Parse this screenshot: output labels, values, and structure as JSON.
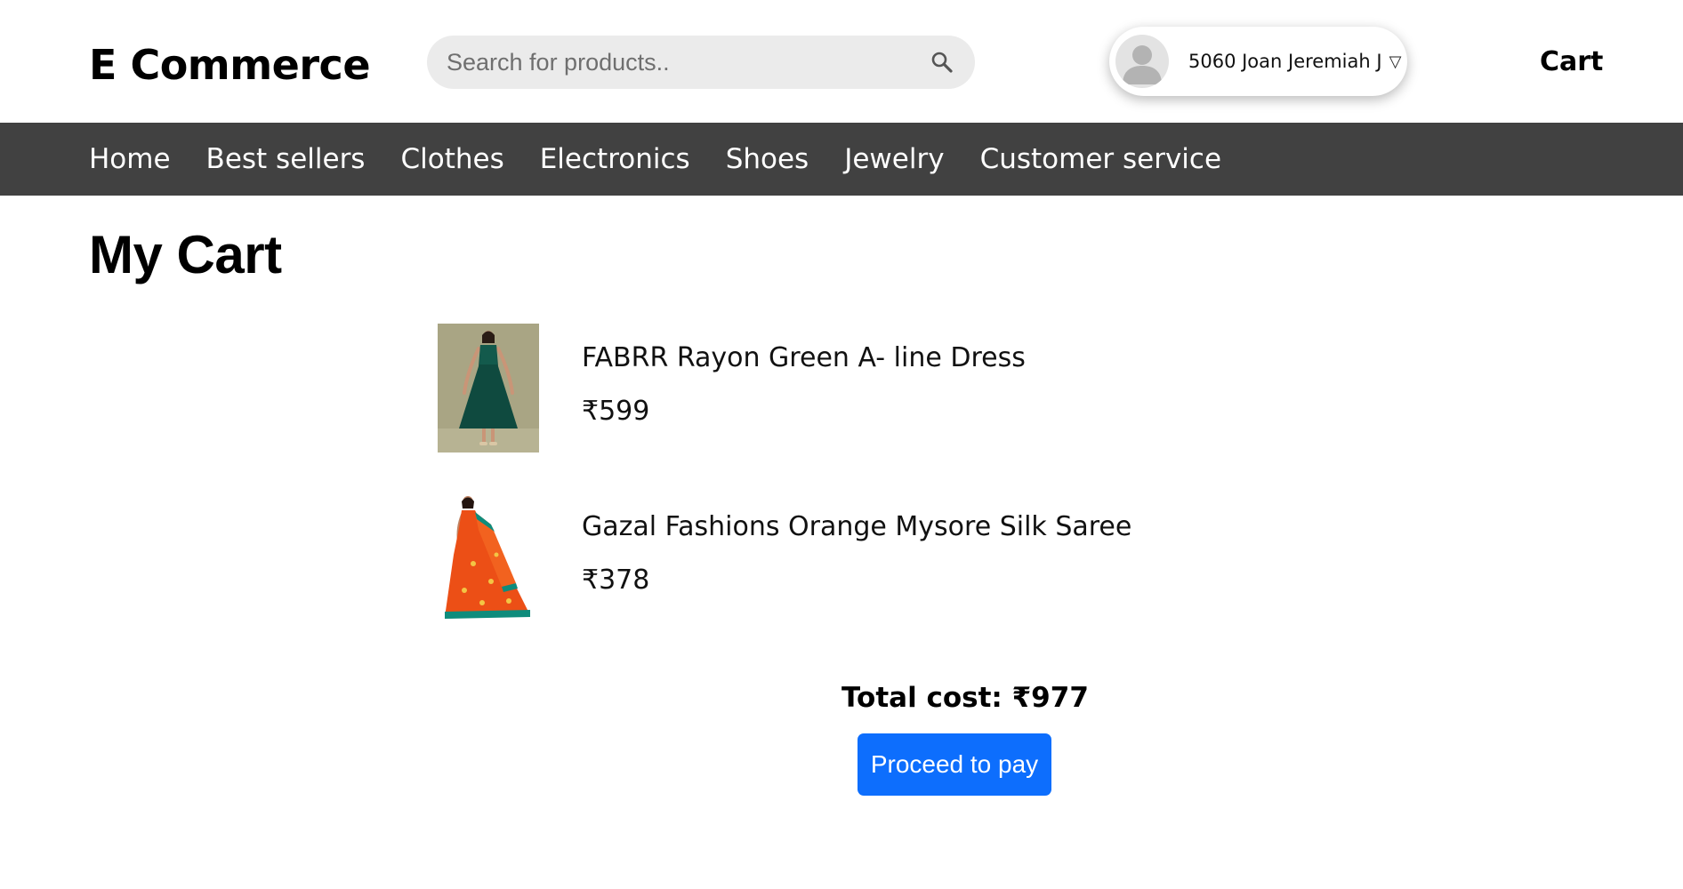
{
  "header": {
    "brand": "E Commerce",
    "search_placeholder": "Search for products..",
    "user_name": "5060 Joan Jeremiah J",
    "caret": "▽",
    "cart_label": "Cart"
  },
  "nav": {
    "items": [
      {
        "label": "Home"
      },
      {
        "label": "Best sellers"
      },
      {
        "label": "Clothes"
      },
      {
        "label": "Electronics"
      },
      {
        "label": "Shoes"
      },
      {
        "label": "Jewelry"
      },
      {
        "label": "Customer service"
      }
    ]
  },
  "main": {
    "title": "My Cart",
    "items": [
      {
        "name": "FABRR Rayon Green A- line Dress",
        "price": "₹599"
      },
      {
        "name": "Gazal Fashions Orange Mysore Silk Saree",
        "price": "₹378"
      }
    ],
    "total": "Total cost: ₹977",
    "pay_label": "Proceed to pay"
  },
  "colors": {
    "nav_bg": "#414141",
    "search_bg": "#ebebeb",
    "button_bg": "#0d6efd",
    "dress": "#0f4a3f",
    "saree": "#ec4f16",
    "saree_border": "#0f8c7c"
  }
}
